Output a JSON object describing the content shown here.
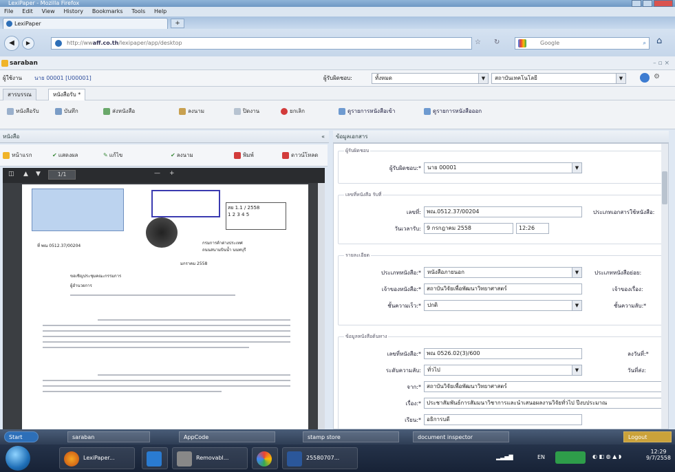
{
  "window": {
    "title": "LexiPaper - Mozilla Firefox"
  },
  "menu": [
    "File",
    "Edit",
    "View",
    "History",
    "Bookmarks",
    "Tools",
    "Help"
  ],
  "browser_tab": {
    "label": "LexiPaper",
    "new_tab": "+"
  },
  "address": {
    "prefix": "http://ww",
    "domain": "aff.co.th",
    "path": "/lexipaper/app/desktop"
  },
  "search": {
    "placeholder": "Google"
  },
  "app": {
    "title": "saraban"
  },
  "user": {
    "label": "ผู้ใช้งาน",
    "value": "นาย 00001 [U00001]",
    "unit_label": "ผู้รับผิดชอบ:",
    "unit_value": "ทั้งหมด",
    "dept_value": "สถาบันเทคโนโลยี"
  },
  "subtabs": [
    "สารบรรณ",
    "หนังสือรับ *"
  ],
  "toolbar": {
    "buttons": [
      "หนังสือรับ",
      "บันทึก",
      "ส่งหนังสือ",
      "ลงนาม",
      "ปิดงาน",
      "ยกเลิก"
    ],
    "links": [
      "ดูรายการหนังสือเข้า",
      "ดูรายการหนังสือออก"
    ]
  },
  "left_pane": {
    "title": "หนังสือ",
    "tools": [
      "หน้าแรก",
      "แสดงผล",
      "แก้ไข",
      "ลงนาม",
      "พิมพ์",
      "ดาวน์โหลด"
    ],
    "viewer_page": "1/1"
  },
  "right_pane": {
    "title": "ข้อมูลเอกสาร"
  },
  "document": {
    "stamp_no": "สย 1.1 / 2558",
    "stamp_no2": "1 2 3 4 5",
    "org_line1": "กรมการค้าต่างประเทศ",
    "org_line2": "ถนนสนามบินน้ำ นนทบุรี",
    "date": "มกราคม 2558",
    "subject": "ขอเชิญประชุมคณะกรรมการ",
    "to": "ผู้อำนวยการ",
    "ref_no": "ที่ พณ 0512.37/00204"
  },
  "form": {
    "sections": [
      "ผู้รับผิดชอบ",
      "เลขที่หนังสือ รับที่",
      "รายละเอียด",
      "ข้อมูลหนังสือต้นทาง"
    ],
    "fields": {
      "owner": {
        "label": "ผู้รับผิดชอบ:*",
        "value": "นาย 00001"
      },
      "doc_no": {
        "label": "เลขที่:",
        "value": "พณ.0512.37/00204"
      },
      "doc_type_side": {
        "label": "ประเภทเอกสารใช้หนังสือ:"
      },
      "recv_date": {
        "label": "วันเวลารับ:",
        "value": "9 กรกฎาคม 2558",
        "time": "12:26"
      },
      "category": {
        "label": "ประเภทหนังสือ:*",
        "value": "หนังสือภายนอก"
      },
      "category_side": {
        "label": "ประเภทหนังสือย่อย:"
      },
      "owner_org": {
        "label": "เจ้าของหนังสือ:*",
        "value": "สถาบันวิจัยเพื่อพัฒนาวิทยาศาสตร์"
      },
      "owner_side": {
        "label": "เจ้าของเรื่อง:"
      },
      "priority": {
        "label": "ชั้นความเร็ว:*",
        "value": "ปกติ"
      },
      "priority_side": {
        "label": "ชั้นความลับ:*"
      },
      "src_no": {
        "label": "เลขที่หนังสือ:*",
        "value": "พณ 0526.02(3)/600"
      },
      "src_date_side": {
        "label": "ลงวันที่:*"
      },
      "src_secret": {
        "label": "ระดับความลับ:",
        "value": "ทั่วไป"
      },
      "src_secret_side": {
        "label": "วันที่ส่ง:"
      },
      "from": {
        "label": "จาก:*",
        "value": "สถาบันวิจัยเพื่อพัฒนาวิทยาศาสตร์"
      },
      "subject": {
        "label": "เรื่อง:*",
        "value": "ประชาสัมพันธ์การสัมมนาวิชาการและนำเสนอผลงานวิจัยทั่วไป ปีงบประมาณ"
      },
      "to": {
        "label": "เรียน:*",
        "value": "อธิการบดี"
      }
    }
  },
  "status_apps": [
    "saraban",
    "AppCode",
    "stamp store",
    "document inspector",
    "Logout"
  ],
  "status_start": "Start",
  "taskbar": {
    "items": [
      "LexiPaper...",
      "Removabl...",
      "25580707..."
    ],
    "lang": "EN",
    "time": "12:29",
    "date": "9/7/2558"
  }
}
